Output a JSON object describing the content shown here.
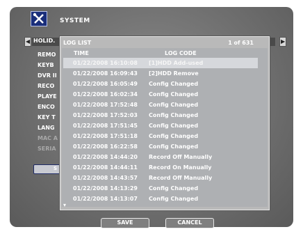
{
  "header": {
    "title": "SYSTEM",
    "icon": "tools-icon"
  },
  "tab": {
    "label": "HOLID."
  },
  "menu": {
    "items": [
      "REMO",
      "KEYB",
      "DVR II",
      "RECO",
      "PLAYE",
      "ENCO",
      "KEY T",
      "LANG",
      "MAC A",
      "SERIA"
    ],
    "dim_items": [
      "MAC A",
      "SERIA"
    ],
    "button_label": "S"
  },
  "log_list": {
    "title": "LOG LIST",
    "page": "1 of 631",
    "columns": {
      "time": "TIME",
      "code": "LOG CODE"
    },
    "rows": [
      {
        "time": "01/22/2008 16:10:08",
        "code": "[1]HDD Add-used",
        "selected": true
      },
      {
        "time": "01/22/2008 16:09:43",
        "code": "[2]HDD Remove"
      },
      {
        "time": "01/22/2008 16:05:49",
        "code": "Config Changed"
      },
      {
        "time": "01/22/2008 16:02:34",
        "code": "Config Changed"
      },
      {
        "time": "01/22/2008 17:52:48",
        "code": "Config Changed"
      },
      {
        "time": "01/22/2008 17:52:03",
        "code": "Config Changed"
      },
      {
        "time": "01/22/2008 17:51:45",
        "code": "Config Changed"
      },
      {
        "time": "01/22/2008 17:51:18",
        "code": "Config Changed"
      },
      {
        "time": "01/22/2008 16:22:58",
        "code": "Config Changed"
      },
      {
        "time": "01/22/2008 14:44:20",
        "code": "Record Off Manually"
      },
      {
        "time": "01/22/2008 14:44:11",
        "code": "Record On Manually"
      },
      {
        "time": "01/22/2008 14:43:57",
        "code": "Record Off Manually"
      },
      {
        "time": "01/22/2008 14:13:29",
        "code": "Config Changed"
      },
      {
        "time": "01/22/2008 14:13:07",
        "code": "Config Changed"
      }
    ]
  },
  "buttons": {
    "save": "SAVE",
    "cancel": "CANCEL"
  },
  "colors": {
    "panel": "#6f6f6f",
    "icon_bg": "#1a2e7a",
    "list_bg": "#aeb0b3",
    "text": "#ffffff"
  }
}
